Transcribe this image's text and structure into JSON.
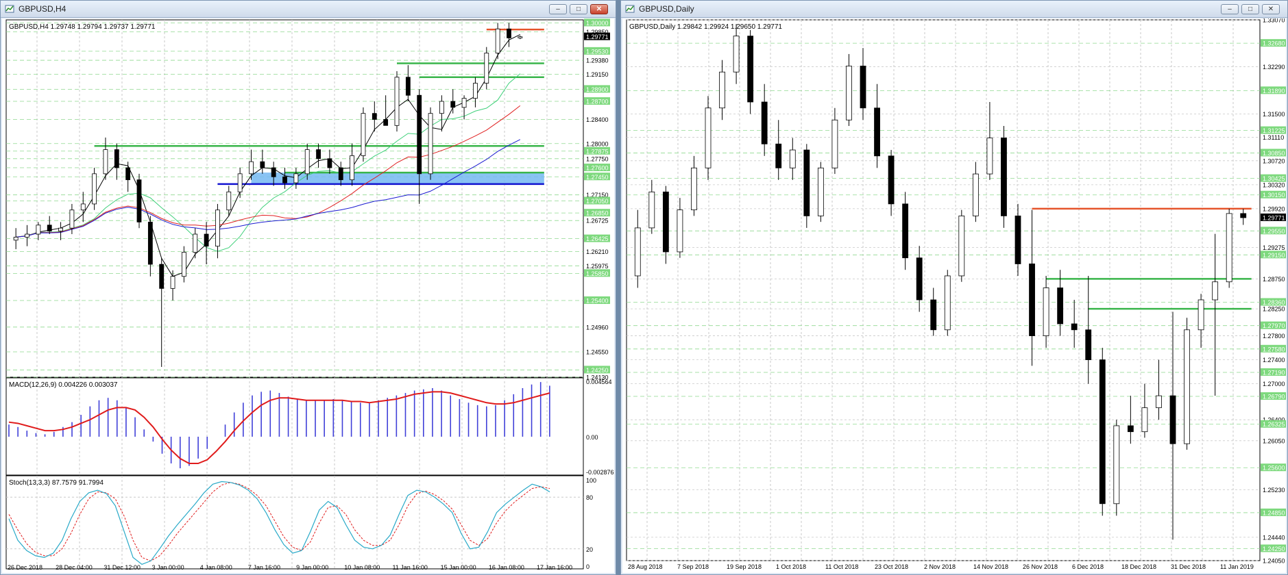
{
  "left_window": {
    "title": "GBPUSD,H4",
    "info": "GBPUSD,H4  1.29748 1.29794 1.29737 1.29771",
    "price_scale": [
      "1.30000",
      "1.29850",
      "1.29530",
      "1.29380",
      "1.29150",
      "1.28900",
      "1.28700",
      "1.28400",
      "1.28000",
      "1.27875",
      "1.27750",
      "1.27600",
      "1.27450",
      "1.27150",
      "1.27050",
      "1.26850",
      "1.26725",
      "1.26425",
      "1.26210",
      "1.25975",
      "1.25850",
      "1.25400",
      "1.24960",
      "1.24550",
      "1.24250",
      "1.24130"
    ],
    "current_price": "1.29771",
    "macd_label": "MACD(12,26,9) 0.004226 0.003037",
    "macd_scale": [
      "0.004564",
      "0.00",
      "-0.002876"
    ],
    "stoch_label": "Stoch(13,3,3) 87.7579 91.7994",
    "stoch_scale": [
      "100",
      "80",
      "20",
      "0"
    ],
    "time_axis": [
      "26 Dec 2018",
      "28 Dec 04:00",
      "31 Dec 12:00",
      "3 Jan 00:00",
      "4 Jan 08:00",
      "7 Jan 16:00",
      "9 Jan 00:00",
      "10 Jan 08:00",
      "11 Jan 16:00",
      "15 Jan 00:00",
      "16 Jan 08:00",
      "17 Jan 16:00"
    ]
  },
  "right_window": {
    "title": "GBPUSD,Daily",
    "info": "GBPUSD,Daily  1.29842 1.29924 1.29650 1.29771",
    "price_scale": [
      "1.33070",
      "1.32680",
      "1.32290",
      "1.31890",
      "1.31500",
      "1.31225",
      "1.31110",
      "1.30850",
      "1.30720",
      "1.30425",
      "1.30320",
      "1.30150",
      "1.29920",
      "1.29550",
      "1.29275",
      "1.29150",
      "1.28750",
      "1.28360",
      "1.28250",
      "1.27970",
      "1.27800",
      "1.27580",
      "1.27400",
      "1.27190",
      "1.27000",
      "1.26790",
      "1.26400",
      "1.26325",
      "1.26050",
      "1.25600",
      "1.25230",
      "1.24850",
      "1.24440",
      "1.24250",
      "1.24050"
    ],
    "current_price": "1.29771",
    "time_axis": [
      "28 Aug 2018",
      "7 Sep 2018",
      "19 Sep 2018",
      "1 Oct 2018",
      "11 Oct 2018",
      "23 Oct 2018",
      "2 Nov 2018",
      "14 Nov 2018",
      "26 Nov 2018",
      "6 Dec 2018",
      "18 Dec 2018",
      "31 Dec 2018",
      "11 Jan 2019"
    ]
  },
  "colors": {
    "up": "#ffffff",
    "down": "#000000",
    "grid": "#c9c9c9",
    "level_green": "#39b54a",
    "level_red": "#e5532a",
    "zone_blue": "#74b8f2",
    "macd_hist": "#3f3fd8",
    "macd_signal": "#e01b1b",
    "stoch_main": "#28a9c8",
    "stoch_signal": "#e01b1b"
  },
  "chart_data": [
    {
      "type": "candlestick",
      "title": "GBPUSD,H4",
      "ylim": [
        1.2413,
        1.3005
      ],
      "levels": {
        "green": [
          1.2933,
          1.291,
          1.2796,
          1.2752
        ],
        "red": [
          1.2989
        ],
        "blue_line": 1.2733
      },
      "candles": [
        [
          1.264,
          1.266,
          1.2625,
          1.2645
        ],
        [
          1.2645,
          1.2665,
          1.263,
          1.265
        ],
        [
          1.265,
          1.267,
          1.264,
          1.2665
        ],
        [
          1.2665,
          1.268,
          1.265,
          1.2655
        ],
        [
          1.2655,
          1.267,
          1.264,
          1.266
        ],
        [
          1.266,
          1.27,
          1.265,
          1.269
        ],
        [
          1.269,
          1.272,
          1.267,
          1.27
        ],
        [
          1.27,
          1.276,
          1.269,
          1.275
        ],
        [
          1.275,
          1.281,
          1.274,
          1.279
        ],
        [
          1.279,
          1.28,
          1.274,
          1.276
        ],
        [
          1.276,
          1.277,
          1.272,
          1.274
        ],
        [
          1.274,
          1.275,
          1.266,
          1.267
        ],
        [
          1.267,
          1.268,
          1.258,
          1.26
        ],
        [
          1.26,
          1.261,
          1.243,
          1.256
        ],
        [
          1.256,
          1.259,
          1.254,
          1.258
        ],
        [
          1.258,
          1.263,
          1.257,
          1.262
        ],
        [
          1.262,
          1.266,
          1.261,
          1.265
        ],
        [
          1.265,
          1.267,
          1.26,
          1.263
        ],
        [
          1.263,
          1.27,
          1.261,
          1.269
        ],
        [
          1.269,
          1.273,
          1.268,
          1.272
        ],
        [
          1.272,
          1.276,
          1.271,
          1.275
        ],
        [
          1.275,
          1.279,
          1.274,
          1.277
        ],
        [
          1.277,
          1.279,
          1.275,
          1.276
        ],
        [
          1.276,
          1.277,
          1.273,
          1.2745
        ],
        [
          1.2745,
          1.276,
          1.2725,
          1.2735
        ],
        [
          1.2735,
          1.276,
          1.2725,
          1.275
        ],
        [
          1.275,
          1.28,
          1.274,
          1.279
        ],
        [
          1.279,
          1.28,
          1.276,
          1.2775
        ],
        [
          1.2775,
          1.279,
          1.275,
          1.276
        ],
        [
          1.276,
          1.277,
          1.273,
          1.274
        ],
        [
          1.274,
          1.28,
          1.273,
          1.278
        ],
        [
          1.278,
          1.286,
          1.277,
          1.285
        ],
        [
          1.285,
          1.287,
          1.282,
          1.284
        ],
        [
          1.284,
          1.288,
          1.283,
          1.283
        ],
        [
          1.283,
          1.292,
          1.282,
          1.291
        ],
        [
          1.291,
          1.293,
          1.287,
          1.288
        ],
        [
          1.288,
          1.289,
          1.27,
          1.275
        ],
        [
          1.275,
          1.286,
          1.274,
          1.285
        ],
        [
          1.285,
          1.288,
          1.282,
          1.287
        ],
        [
          1.287,
          1.289,
          1.285,
          1.286
        ],
        [
          1.286,
          1.288,
          1.284,
          1.2875
        ],
        [
          1.2875,
          1.291,
          1.286,
          1.29
        ],
        [
          1.29,
          1.296,
          1.289,
          1.295
        ],
        [
          1.295,
          1.3,
          1.294,
          1.299
        ],
        [
          1.299,
          1.3,
          1.296,
          1.2975
        ],
        [
          1.2975,
          1.2979,
          1.2973,
          1.2977
        ]
      ]
    },
    {
      "type": "candlestick",
      "title": "GBPUSD,Daily",
      "ylim": [
        1.2405,
        1.3307
      ],
      "levels": {
        "green": [
          1.2875,
          1.2825
        ],
        "red": [
          1.2992
        ]
      },
      "candles": [
        [
          1.288,
          1.299,
          1.286,
          1.296
        ],
        [
          1.296,
          1.304,
          1.295,
          1.302
        ],
        [
          1.302,
          1.303,
          1.29,
          1.292
        ],
        [
          1.292,
          1.301,
          1.291,
          1.299
        ],
        [
          1.299,
          1.308,
          1.298,
          1.306
        ],
        [
          1.306,
          1.318,
          1.304,
          1.316
        ],
        [
          1.316,
          1.324,
          1.314,
          1.322
        ],
        [
          1.322,
          1.33,
          1.32,
          1.328
        ],
        [
          1.328,
          1.329,
          1.315,
          1.317
        ],
        [
          1.317,
          1.32,
          1.308,
          1.31
        ],
        [
          1.31,
          1.314,
          1.304,
          1.306
        ],
        [
          1.306,
          1.311,
          1.304,
          1.309
        ],
        [
          1.309,
          1.31,
          1.296,
          1.298
        ],
        [
          1.298,
          1.307,
          1.297,
          1.306
        ],
        [
          1.306,
          1.316,
          1.305,
          1.314
        ],
        [
          1.314,
          1.325,
          1.313,
          1.323
        ],
        [
          1.323,
          1.326,
          1.314,
          1.316
        ],
        [
          1.316,
          1.32,
          1.306,
          1.308
        ],
        [
          1.308,
          1.309,
          1.298,
          1.3
        ],
        [
          1.3,
          1.302,
          1.289,
          1.291
        ],
        [
          1.291,
          1.293,
          1.282,
          1.284
        ],
        [
          1.284,
          1.286,
          1.278,
          1.279
        ],
        [
          1.279,
          1.289,
          1.278,
          1.288
        ],
        [
          1.288,
          1.299,
          1.287,
          1.298
        ],
        [
          1.298,
          1.307,
          1.297,
          1.305
        ],
        [
          1.305,
          1.317,
          1.304,
          1.311
        ],
        [
          1.311,
          1.313,
          1.296,
          1.298
        ],
        [
          1.298,
          1.3,
          1.288,
          1.29
        ],
        [
          1.29,
          1.299,
          1.273,
          1.278
        ],
        [
          1.278,
          1.288,
          1.276,
          1.286
        ],
        [
          1.286,
          1.289,
          1.278,
          1.28
        ],
        [
          1.28,
          1.284,
          1.276,
          1.279
        ],
        [
          1.279,
          1.288,
          1.27,
          1.274
        ],
        [
          1.274,
          1.276,
          1.248,
          1.25
        ],
        [
          1.25,
          1.264,
          1.248,
          1.263
        ],
        [
          1.263,
          1.268,
          1.26,
          1.262
        ],
        [
          1.262,
          1.27,
          1.261,
          1.266
        ],
        [
          1.266,
          1.274,
          1.264,
          1.268
        ],
        [
          1.268,
          1.282,
          1.244,
          1.26
        ],
        [
          1.26,
          1.281,
          1.259,
          1.279
        ],
        [
          1.279,
          1.285,
          1.276,
          1.284
        ],
        [
          1.284,
          1.295,
          1.268,
          1.287
        ],
        [
          1.287,
          1.2992,
          1.286,
          1.2984
        ],
        [
          1.2984,
          1.2992,
          1.2965,
          1.2977
        ]
      ]
    },
    {
      "type": "macd",
      "title": "MACD(12,26,9)",
      "values": [
        0.001,
        0.0008,
        0.0005,
        0.0003,
        0.0002,
        0.0004,
        0.0008,
        0.0012,
        0.0018,
        0.0025,
        0.003,
        0.0032,
        0.003,
        0.0024,
        0.0016,
        0.0006,
        -0.0004,
        -0.0014,
        -0.0022,
        -0.0026,
        -0.0024,
        -0.0018,
        -0.001,
        0.0,
        0.001,
        0.002,
        0.0028,
        0.0034,
        0.0037,
        0.0038,
        0.0036,
        0.0033,
        0.0031,
        0.003,
        0.003,
        0.003,
        0.0031,
        0.003,
        0.0029,
        0.0028,
        0.0028,
        0.003,
        0.0032,
        0.0034,
        0.0036,
        0.0038,
        0.0039,
        0.004,
        0.0038,
        0.0034,
        0.0031,
        0.0028,
        0.0026,
        0.0025,
        0.0026,
        0.003,
        0.0035,
        0.004,
        0.0043,
        0.0045,
        0.0042
      ],
      "signal": [
        0.0012,
        0.0011,
        0.0009,
        0.0007,
        0.0005,
        0.0005,
        0.0006,
        0.0008,
        0.0011,
        0.0014,
        0.0018,
        0.0022,
        0.0024,
        0.0024,
        0.0022,
        0.0016,
        0.0008,
        -0.0002,
        -0.0011,
        -0.0018,
        -0.0022,
        -0.0022,
        -0.0019,
        -0.0012,
        -0.0004,
        0.0005,
        0.0013,
        0.002,
        0.0026,
        0.003,
        0.0032,
        0.0032,
        0.0031,
        0.003,
        0.003,
        0.003,
        0.003,
        0.003,
        0.0029,
        0.0029,
        0.0028,
        0.0029,
        0.003,
        0.0031,
        0.0033,
        0.0035,
        0.0036,
        0.0037,
        0.0037,
        0.0036,
        0.0034,
        0.0032,
        0.003,
        0.0028,
        0.0027,
        0.0027,
        0.0028,
        0.003,
        0.0032,
        0.0034,
        0.0036
      ],
      "ylim": [
        -0.002876,
        0.004564
      ]
    },
    {
      "type": "line",
      "title": "Stoch(13,3,3)",
      "series": [
        {
          "name": "main",
          "values": [
            55,
            30,
            18,
            12,
            10,
            15,
            30,
            55,
            75,
            85,
            88,
            84,
            70,
            40,
            10,
            2,
            6,
            20,
            35,
            48,
            60,
            72,
            85,
            95,
            98,
            97,
            94,
            88,
            78,
            62,
            42,
            25,
            15,
            18,
            40,
            65,
            75,
            68,
            48,
            30,
            22,
            20,
            24,
            36,
            60,
            82,
            88,
            86,
            80,
            72,
            62,
            38,
            20,
            22,
            40,
            62,
            72,
            80,
            88,
            95,
            92,
            86
          ]
        },
        {
          "name": "signal",
          "values": [
            60,
            42,
            26,
            16,
            12,
            12,
            20,
            38,
            60,
            78,
            86,
            85,
            78,
            58,
            30,
            10,
            6,
            12,
            24,
            38,
            50,
            62,
            74,
            86,
            94,
            97,
            95,
            90,
            82,
            70,
            52,
            34,
            22,
            18,
            28,
            50,
            68,
            70,
            60,
            42,
            30,
            24,
            24,
            30,
            48,
            70,
            84,
            87,
            83,
            76,
            66,
            48,
            30,
            24,
            32,
            50,
            64,
            74,
            82,
            90,
            92,
            90
          ]
        }
      ],
      "ylim": [
        0,
        100
      ]
    }
  ]
}
